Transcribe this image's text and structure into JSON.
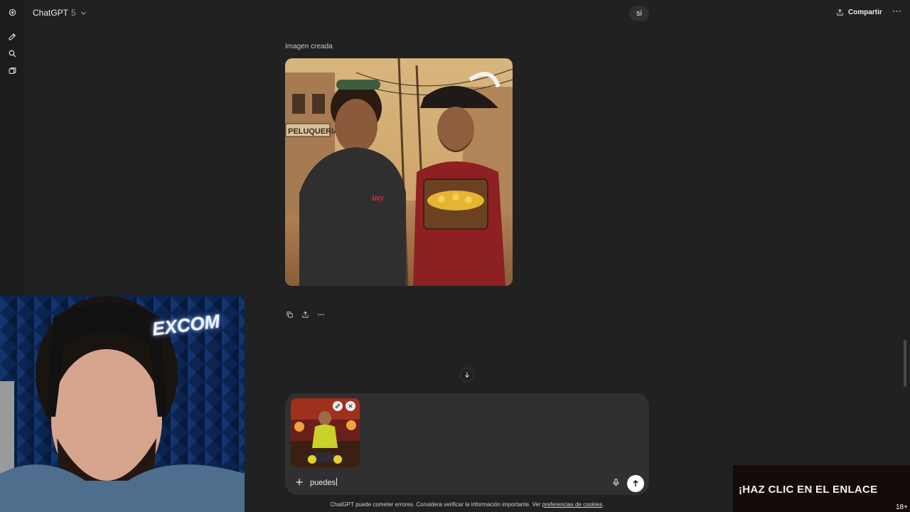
{
  "header": {
    "model_name": "ChatGPT",
    "model_version": "5",
    "share_label": "Compartir",
    "more_label": "⋯"
  },
  "conversation": {
    "user_message": "si",
    "assistant": {
      "image_label": "Imagen creada",
      "image_sign_text": "PELUQUERIA",
      "image_shirt_text": "iny"
    }
  },
  "composer": {
    "input_value": "puedes",
    "disclaimer_text": "ChatGPT puede cometer errores. Considera verificar la información importante. Ver ",
    "disclaimer_link": "preferencias de cookies",
    "disclaimer_end": "."
  },
  "webcam": {
    "sign_text": "EXCOM"
  },
  "ad": {
    "text": "¡HAZ CLIC EN EL ENLACE",
    "age": "18+"
  },
  "colors": {
    "background": "#212121",
    "composer": "#303030",
    "send_button": "#ffffff"
  }
}
